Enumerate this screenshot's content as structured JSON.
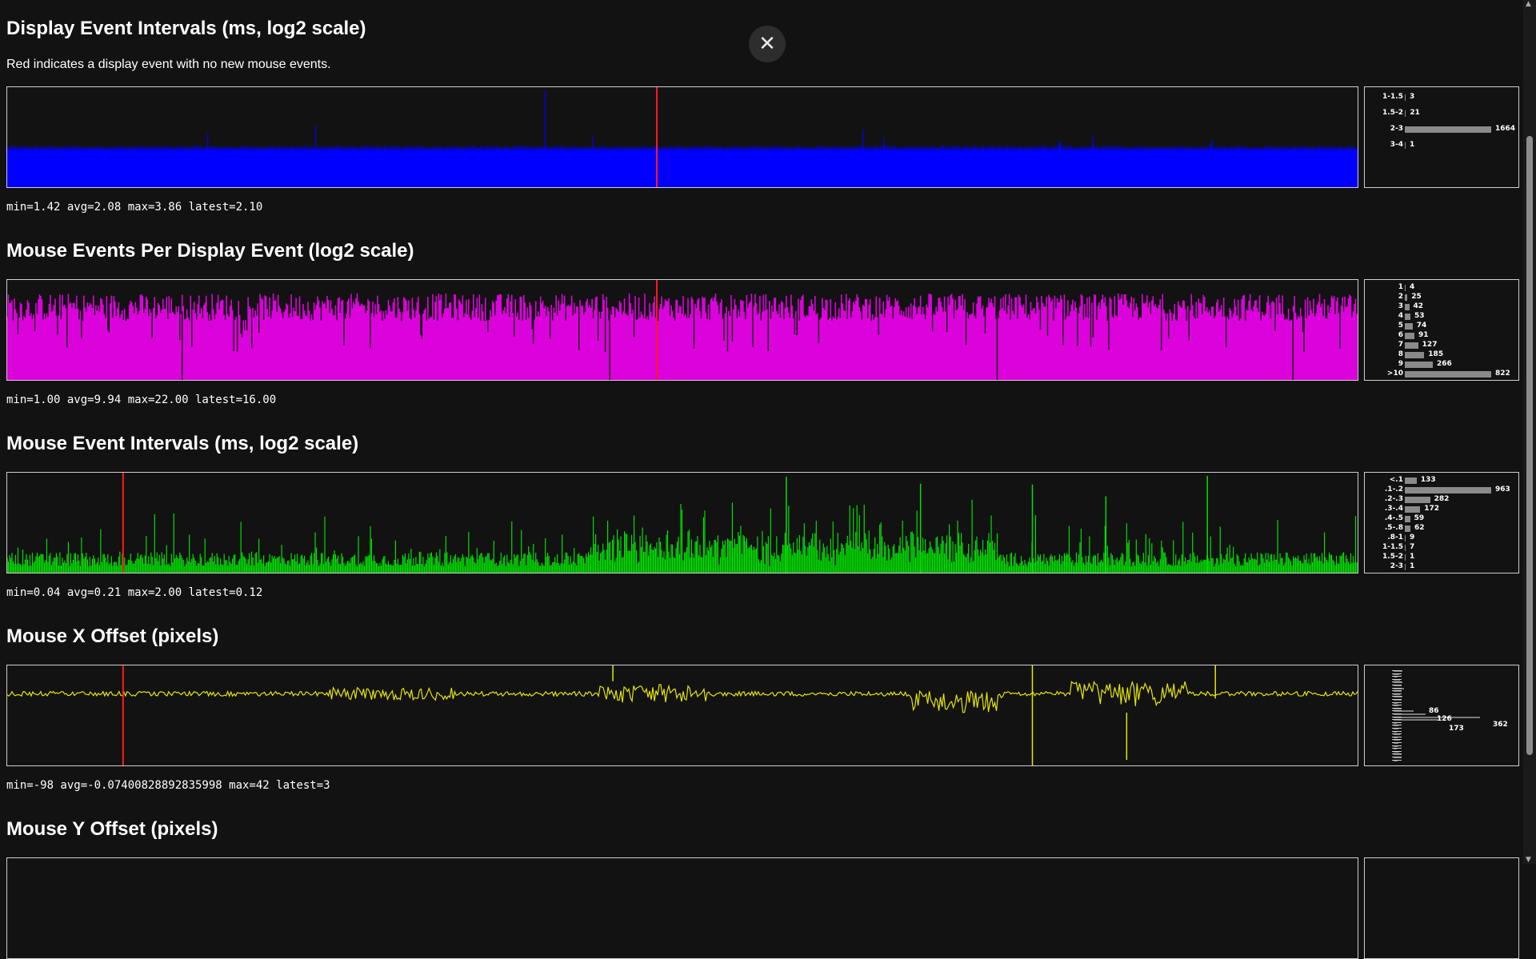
{
  "close_label": "✕",
  "sections": [
    {
      "title": "Display Event Intervals (ms, log2 scale)",
      "subtitle": "Red indicates a display event with no new mouse events.",
      "stats": "min=1.42 avg=2.08 max=3.86 latest=2.10",
      "color": "#0000ff",
      "chart_data": {
        "type": "bar",
        "title": "Display Event Intervals (ms, log2 scale)",
        "scale": "log2",
        "min": 1.42,
        "avg": 2.08,
        "max": 3.86,
        "latest": 2.1,
        "marker_color": "#ff0000"
      },
      "histogram": [
        {
          "label": "1-1.5",
          "count": "3",
          "value": 3
        },
        {
          "label": "1.5-2",
          "count": "21",
          "value": 21
        },
        {
          "label": "2-3",
          "count": "1664",
          "value": 1664
        },
        {
          "label": "3-4",
          "count": "1",
          "value": 1
        }
      ]
    },
    {
      "title": "Mouse Events Per Display Event (log2 scale)",
      "subtitle": "",
      "stats": "min=1.00 avg=9.94 max=22.00 latest=16.00",
      "color": "#ff00ff",
      "chart_data": {
        "type": "bar",
        "title": "Mouse Events Per Display Event (log2 scale)",
        "scale": "log2",
        "min": 1.0,
        "avg": 9.94,
        "max": 22.0,
        "latest": 16.0,
        "marker_color": "#ff0000"
      },
      "histogram": [
        {
          "label": "1",
          "count": "4",
          "value": 4
        },
        {
          "label": "2",
          "count": "25",
          "value": 25
        },
        {
          "label": "3",
          "count": "42",
          "value": 42
        },
        {
          "label": "4",
          "count": "53",
          "value": 53
        },
        {
          "label": "5",
          "count": "74",
          "value": 74
        },
        {
          "label": "6",
          "count": "91",
          "value": 91
        },
        {
          "label": "7",
          "count": "127",
          "value": 127
        },
        {
          "label": "8",
          "count": "185",
          "value": 185
        },
        {
          "label": "9",
          "count": "266",
          "value": 266
        },
        {
          "label": ">10",
          "count": "822",
          "value": 822
        }
      ]
    },
    {
      "title": "Mouse Event Intervals (ms, log2 scale)",
      "subtitle": "",
      "stats": "min=0.04 avg=0.21 max=2.00 latest=0.12",
      "color": "#00e000",
      "chart_data": {
        "type": "bar",
        "title": "Mouse Event Intervals (ms, log2 scale)",
        "scale": "log2",
        "min": 0.04,
        "avg": 0.21,
        "max": 2.0,
        "latest": 0.12,
        "marker_color": "#ff0000"
      },
      "histogram": [
        {
          "label": "<.1",
          "count": "133",
          "value": 133
        },
        {
          "label": ".1-.2",
          "count": "963",
          "value": 963
        },
        {
          "label": ".2-.3",
          "count": "282",
          "value": 282
        },
        {
          "label": ".3-.4",
          "count": "172",
          "value": 172
        },
        {
          "label": ".4-.5",
          "count": "59",
          "value": 59
        },
        {
          "label": ".5-.8",
          "count": "62",
          "value": 62
        },
        {
          "label": ".8-1",
          "count": "9",
          "value": 9
        },
        {
          "label": "1-1.5",
          "count": "7",
          "value": 7
        },
        {
          "label": "1.5-2",
          "count": "1",
          "value": 1
        },
        {
          "label": "2-3",
          "count": "1",
          "value": 1
        }
      ]
    },
    {
      "title": "Mouse X Offset (pixels)",
      "subtitle": "",
      "stats": "min=-98 avg=-0.07400828892835998 max=42 latest=3",
      "color": "#e6e600",
      "chart_data": {
        "type": "line",
        "title": "Mouse X Offset (pixels)",
        "min": -98,
        "avg": -0.07400828892835998,
        "max": 42,
        "latest": 3,
        "marker_color": "#ff0000"
      },
      "histogram_visible_counts": [
        "362",
        "173",
        "126",
        "86"
      ]
    },
    {
      "title": "Mouse Y Offset (pixels)",
      "subtitle": "",
      "stats": "",
      "color": "#e6e600"
    }
  ]
}
